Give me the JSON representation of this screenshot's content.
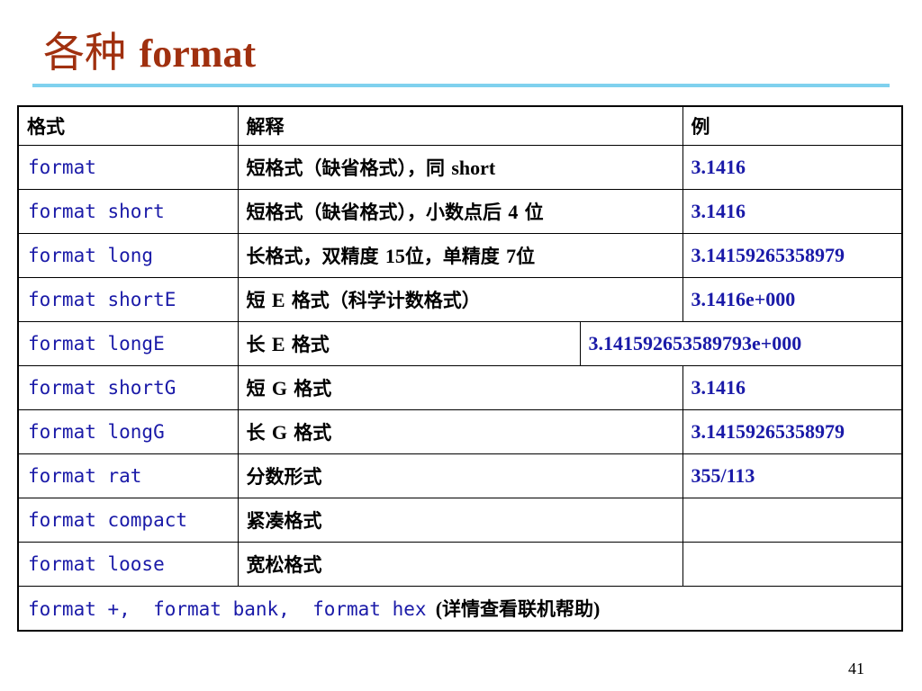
{
  "slide": {
    "title_cn": "各种",
    "title_en": "format",
    "page_number": "41"
  },
  "table": {
    "headers": [
      "格式",
      "解释",
      "例"
    ],
    "rows": [
      {
        "command": "format",
        "desc_pre": "短格式（缺省格式），同",
        "desc_num": "short",
        "desc_post": "",
        "example": "3.1416"
      },
      {
        "command": "format short",
        "desc_pre": "短格式（缺省格式），小数点后",
        "desc_num": "4",
        "desc_post": "位",
        "example": "3.1416"
      },
      {
        "command": "format long",
        "desc_pre": "长格式，双精度",
        "desc_num": "15",
        "desc_post": "位，单精度",
        "desc_num2": "7",
        "desc_post2": "位",
        "example": "3.14159265358979"
      },
      {
        "command": "format shortE",
        "desc_pre": "短",
        "desc_num": "E",
        "desc_post": "格式（科学计数格式）",
        "example": "3.1416e+000"
      },
      {
        "command": "format longE",
        "desc_pre": "长",
        "desc_num": "E",
        "desc_post": "格式",
        "example": "3.141592653589793e+000"
      },
      {
        "command": "format shortG",
        "desc_pre": "短",
        "desc_num": "G",
        "desc_post": "格式",
        "example": "3.1416"
      },
      {
        "command": "format longG",
        "desc_pre": "长",
        "desc_num": "G",
        "desc_post": "格式",
        "example": "3.14159265358979"
      },
      {
        "command": "format rat",
        "desc_pre": "分数形式",
        "example": "355/113"
      },
      {
        "command": "format compact",
        "desc_pre": "紧凑格式",
        "example": ""
      },
      {
        "command": "format loose",
        "desc_pre": "宽松格式",
        "example": ""
      }
    ],
    "footer": {
      "commands": "format +,  format bank,  format hex",
      "paren_open": "(",
      "note": "详情查看联机帮助",
      "paren_close": ")"
    }
  }
}
